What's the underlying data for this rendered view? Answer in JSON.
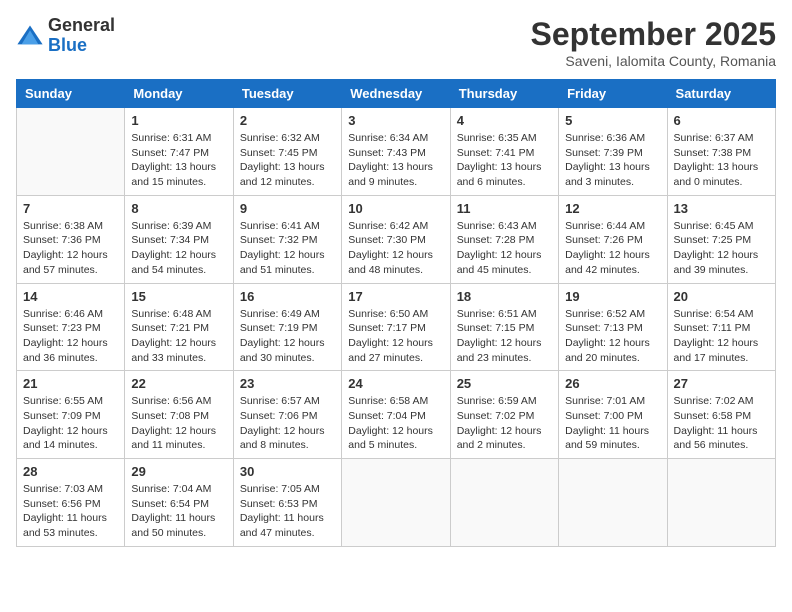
{
  "logo": {
    "general": "General",
    "blue": "Blue"
  },
  "title": "September 2025",
  "subtitle": "Saveni, Ialomita County, Romania",
  "weekdays": [
    "Sunday",
    "Monday",
    "Tuesday",
    "Wednesday",
    "Thursday",
    "Friday",
    "Saturday"
  ],
  "weeks": [
    [
      {
        "day": "",
        "empty": true
      },
      {
        "day": "1",
        "sunrise": "6:31 AM",
        "sunset": "7:47 PM",
        "daylight": "13 hours and 15 minutes."
      },
      {
        "day": "2",
        "sunrise": "6:32 AM",
        "sunset": "7:45 PM",
        "daylight": "13 hours and 12 minutes."
      },
      {
        "day": "3",
        "sunrise": "6:34 AM",
        "sunset": "7:43 PM",
        "daylight": "13 hours and 9 minutes."
      },
      {
        "day": "4",
        "sunrise": "6:35 AM",
        "sunset": "7:41 PM",
        "daylight": "13 hours and 6 minutes."
      },
      {
        "day": "5",
        "sunrise": "6:36 AM",
        "sunset": "7:39 PM",
        "daylight": "13 hours and 3 minutes."
      },
      {
        "day": "6",
        "sunrise": "6:37 AM",
        "sunset": "7:38 PM",
        "daylight": "13 hours and 0 minutes."
      }
    ],
    [
      {
        "day": "7",
        "sunrise": "6:38 AM",
        "sunset": "7:36 PM",
        "daylight": "12 hours and 57 minutes."
      },
      {
        "day": "8",
        "sunrise": "6:39 AM",
        "sunset": "7:34 PM",
        "daylight": "12 hours and 54 minutes."
      },
      {
        "day": "9",
        "sunrise": "6:41 AM",
        "sunset": "7:32 PM",
        "daylight": "12 hours and 51 minutes."
      },
      {
        "day": "10",
        "sunrise": "6:42 AM",
        "sunset": "7:30 PM",
        "daylight": "12 hours and 48 minutes."
      },
      {
        "day": "11",
        "sunrise": "6:43 AM",
        "sunset": "7:28 PM",
        "daylight": "12 hours and 45 minutes."
      },
      {
        "day": "12",
        "sunrise": "6:44 AM",
        "sunset": "7:26 PM",
        "daylight": "12 hours and 42 minutes."
      },
      {
        "day": "13",
        "sunrise": "6:45 AM",
        "sunset": "7:25 PM",
        "daylight": "12 hours and 39 minutes."
      }
    ],
    [
      {
        "day": "14",
        "sunrise": "6:46 AM",
        "sunset": "7:23 PM",
        "daylight": "12 hours and 36 minutes."
      },
      {
        "day": "15",
        "sunrise": "6:48 AM",
        "sunset": "7:21 PM",
        "daylight": "12 hours and 33 minutes."
      },
      {
        "day": "16",
        "sunrise": "6:49 AM",
        "sunset": "7:19 PM",
        "daylight": "12 hours and 30 minutes."
      },
      {
        "day": "17",
        "sunrise": "6:50 AM",
        "sunset": "7:17 PM",
        "daylight": "12 hours and 27 minutes."
      },
      {
        "day": "18",
        "sunrise": "6:51 AM",
        "sunset": "7:15 PM",
        "daylight": "12 hours and 23 minutes."
      },
      {
        "day": "19",
        "sunrise": "6:52 AM",
        "sunset": "7:13 PM",
        "daylight": "12 hours and 20 minutes."
      },
      {
        "day": "20",
        "sunrise": "6:54 AM",
        "sunset": "7:11 PM",
        "daylight": "12 hours and 17 minutes."
      }
    ],
    [
      {
        "day": "21",
        "sunrise": "6:55 AM",
        "sunset": "7:09 PM",
        "daylight": "12 hours and 14 minutes."
      },
      {
        "day": "22",
        "sunrise": "6:56 AM",
        "sunset": "7:08 PM",
        "daylight": "12 hours and 11 minutes."
      },
      {
        "day": "23",
        "sunrise": "6:57 AM",
        "sunset": "7:06 PM",
        "daylight": "12 hours and 8 minutes."
      },
      {
        "day": "24",
        "sunrise": "6:58 AM",
        "sunset": "7:04 PM",
        "daylight": "12 hours and 5 minutes."
      },
      {
        "day": "25",
        "sunrise": "6:59 AM",
        "sunset": "7:02 PM",
        "daylight": "12 hours and 2 minutes."
      },
      {
        "day": "26",
        "sunrise": "7:01 AM",
        "sunset": "7:00 PM",
        "daylight": "11 hours and 59 minutes."
      },
      {
        "day": "27",
        "sunrise": "7:02 AM",
        "sunset": "6:58 PM",
        "daylight": "11 hours and 56 minutes."
      }
    ],
    [
      {
        "day": "28",
        "sunrise": "7:03 AM",
        "sunset": "6:56 PM",
        "daylight": "11 hours and 53 minutes."
      },
      {
        "day": "29",
        "sunrise": "7:04 AM",
        "sunset": "6:54 PM",
        "daylight": "11 hours and 50 minutes."
      },
      {
        "day": "30",
        "sunrise": "7:05 AM",
        "sunset": "6:53 PM",
        "daylight": "11 hours and 47 minutes."
      },
      {
        "day": "",
        "empty": true
      },
      {
        "day": "",
        "empty": true
      },
      {
        "day": "",
        "empty": true
      },
      {
        "day": "",
        "empty": true
      }
    ]
  ],
  "labels": {
    "sunrise": "Sunrise:",
    "sunset": "Sunset:",
    "daylight": "Daylight:"
  }
}
